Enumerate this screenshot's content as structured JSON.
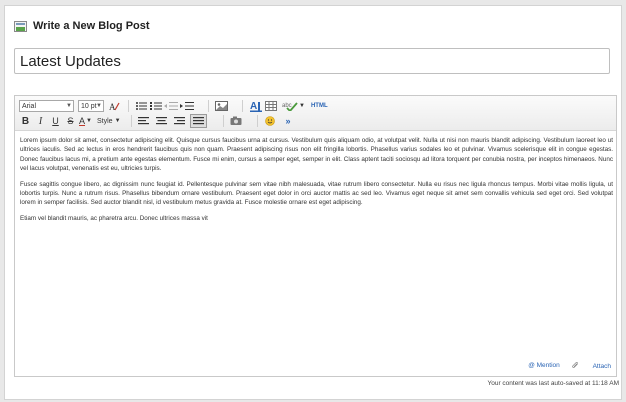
{
  "header": {
    "title": "Write a New Blog Post",
    "icon": "blog-post-icon"
  },
  "post_title": {
    "value": "Latest Updates"
  },
  "toolbar": {
    "font_family": "Arial",
    "font_size": "10 pt",
    "style_label": "Style",
    "html_label": "HTML",
    "bold_glyph": "B",
    "italic_glyph": "I",
    "underline_glyph": "U",
    "strike_glyph": "S",
    "text_color_glyph": "A",
    "expand_glyph": "»"
  },
  "content": {
    "paragraphs": [
      "Lorem ipsum dolor sit amet, consectetur adipiscing elit. Quisque cursus faucibus urna at cursus. Vestibulum quis aliquam odio, at volutpat velit. Nulla ut nisi non mauris blandit adipiscing. Vestibulum laoreet leo ut ultrices iaculis. Sed ac lectus in eros hendrerit faucibus quis non quam. Praesent adipiscing risus non elit fringilla lobortis. Phasellus varius sodales leo et pulvinar. Vivamus scelerisque elit in congue egestas. Donec faucibus lacus mi, a pretium ante egestas elementum. Fusce mi enim, cursus a semper eget, semper in elit. Class aptent taciti sociosqu ad litora torquent per conubia nostra, per inceptos himenaeos. Nunc vel lacus volutpat, venenatis est eu, ultricies turpis.",
      "Fusce sagittis congue libero, ac dignissim nunc feugiat id. Pellentesque pulvinar sem vitae nibh malesuada, vitae rutrum libero consectetur. Nulla eu risus nec ligula rhoncus tempus. Morbi vitae mollis ligula, ut lobortis turpis. Nunc a rutrum risus. Phasellus bibendum ornare vestibulum. Praesent eget dolor in orci auctor mattis ac sed leo. Vivamus eget neque sit amet sem convallis vehicula sed eget orci. Sed volutpat lorem in semper facilisis. Sed auctor blandit nisl, id vestibulum metus gravida at. Fusce molestie ornare est eget adipiscing.",
      "Etiam vel blandit mauris, ac pharetra arcu. Donec ultrices massa vit"
    ]
  },
  "footer": {
    "mention_label": "@ Mention",
    "attach_label": "Attach",
    "autosave_text": "Your content was last auto-saved at 11:18 AM"
  },
  "colors": {
    "link": "#2a64b4",
    "accent_green": "#5aa34a"
  }
}
